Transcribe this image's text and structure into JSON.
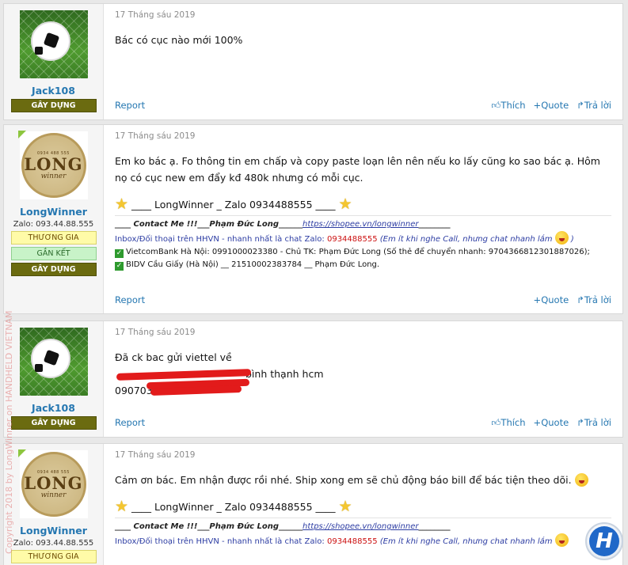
{
  "posts": [
    {
      "user": {
        "name": "Jack108",
        "badges": [
          "GÂY DỰNG"
        ]
      },
      "date": "17 Tháng sáu 2019",
      "message": "Bác có cục nào mới 100%",
      "footer": {
        "report": "Report",
        "like": "Thích",
        "quote": "Quote",
        "reply": "Trả lời"
      }
    },
    {
      "user": {
        "name": "LongWinner",
        "zalo": "Zalo: 093.44.88.555",
        "badges": [
          "THƯƠNG GIA",
          "GẮN KẾT",
          "GÂY DỰNG"
        ]
      },
      "date": "17 Tháng sáu 2019",
      "message": "Em ko bác ạ. Fo thông tin em chấp và copy paste loạn lên nên nếu ko lấy cũng ko sao bác ạ. Hôm nọ có cục new em đẩy kđ 480k nhưng có mỗi cục.",
      "signature": {
        "name_line": "____ LongWinner _ Zalo 0934488555 ____",
        "contact_italic": "____ Contact Me !!!___Phạm Đức Long______",
        "contact_link": "https://shopee.vn/longwinner",
        "contact_tail": "________",
        "inbox_text": "Inbox/Đối thoại trên HHVN - nhanh nhất là chat Zalo: ",
        "inbox_phone": "0934488555",
        "inbox_note": " (Em ít khi nghe Call, nhưng chat nhanh lắm",
        "inbox_close": " )",
        "bank1": "VietcomBank Hà Nội: 0991000023380 - Chủ TK: Phạm Đức Long (Số thẻ để chuyển nhanh: 9704366812301887026);",
        "bank2": "BIDV Cầu Giấy (Hà Nội) __ 21510002383784 __ Phạm Đức Long."
      },
      "footer": {
        "report": "Report",
        "quote": "Quote",
        "reply": "Trả lời"
      }
    },
    {
      "user": {
        "name": "Jack108",
        "badges": [
          "GÂY DỰNG"
        ]
      },
      "date": "17 Tháng sáu 2019",
      "message_line1": "Đã ck bac gửi viettel về",
      "message_line2_visible": "bình thạnh hcm",
      "message_line3_visible": "090703",
      "footer": {
        "report": "Report",
        "like": "Thích",
        "quote": "Quote",
        "reply": "Trả lời"
      }
    },
    {
      "user": {
        "name": "LongWinner",
        "zalo": "Zalo: 093.44.88.555",
        "badges": [
          "THƯƠNG GIA"
        ]
      },
      "date": "17 Tháng sáu 2019",
      "message": "Cảm ơn bác. Em nhận được rồi nhé. Ship xong em sẽ chủ động báo bill để bác tiện theo dõi.",
      "signature": {
        "name_line": "____ LongWinner _ Zalo 0934488555 ____",
        "contact_italic": "____ Contact Me !!!___Phạm Đức Long______",
        "contact_link": "https://shopee.vn/longwinner",
        "contact_tail": "________",
        "inbox_text": "Inbox/Đối thoại trên HHVN - nhanh nhất là chat Zalo: ",
        "inbox_phone": "0934488555",
        "inbox_note": " (Em ít khi nghe Call, nhưng chat nhanh lắm"
      }
    }
  ],
  "avatar_text": {
    "big": "LONG",
    "small": "winner",
    "phone": "0934 488 555"
  },
  "watermark": "Copyright 2018 by LongWinner on HANDHELD VIETNAM",
  "logo_letter": "H",
  "colors": {
    "link": "#2577b1",
    "badge_gay": "#6b6b10",
    "badge_thuong": "#fffba8",
    "badge_gan": "#c8f3c8",
    "star": "#f4c630",
    "phone_red": "#cc1010"
  }
}
